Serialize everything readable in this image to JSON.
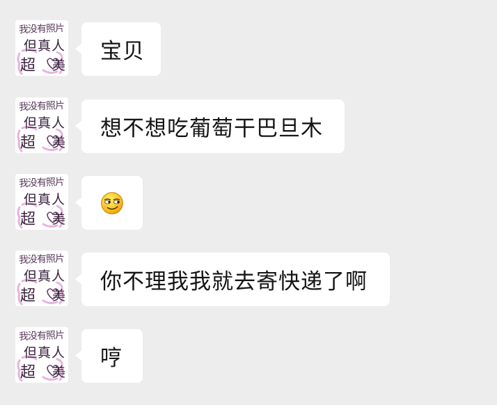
{
  "contact": {
    "avatar_text": {
      "line1": "我没有照片",
      "line2": "但真人",
      "line3_left": "超",
      "line3_right": "美"
    }
  },
  "messages": [
    {
      "type": "text",
      "text": "宝贝"
    },
    {
      "type": "text",
      "text": "想不想吃葡萄干巴旦木"
    },
    {
      "type": "emoji",
      "emoji": "smirk-face-icon"
    },
    {
      "type": "text",
      "text": "你不理我我就去寄快递了啊"
    },
    {
      "type": "text",
      "text": "哼"
    }
  ],
  "colors": {
    "background": "#ededed",
    "bubble": "#ffffff",
    "text": "#151515",
    "avatar_accent": "#e6b3df"
  }
}
